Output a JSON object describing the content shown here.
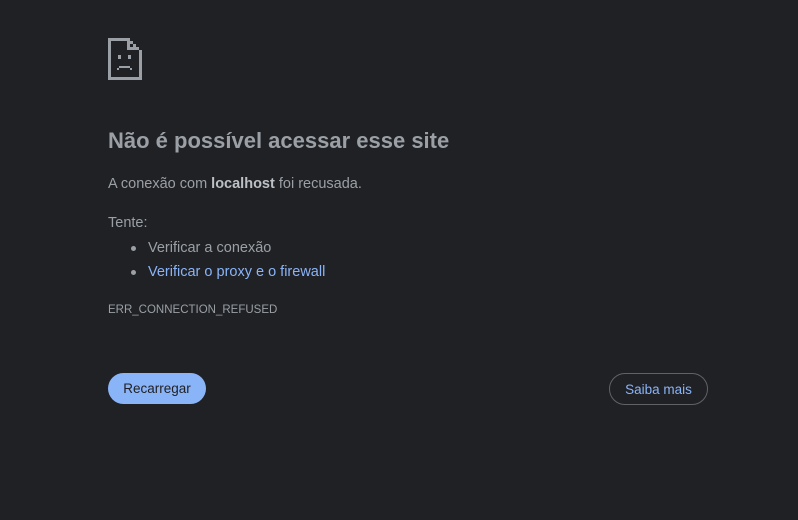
{
  "error": {
    "icon": "sad-document-icon",
    "title": "Não é possível acessar esse site",
    "description_before": "A conexão com ",
    "host": "localhost",
    "description_after": " foi recusada.",
    "try_label": "Tente:",
    "suggestions": [
      {
        "label": "Verificar a conexão",
        "link": false
      },
      {
        "label": "Verificar o proxy e o firewall",
        "link": true
      }
    ],
    "code": "ERR_CONNECTION_REFUSED"
  },
  "buttons": {
    "reload_label": "Recarregar",
    "learn_more_label": "Saiba mais"
  },
  "colors": {
    "background": "#202124",
    "text": "#9aa0a6",
    "accent": "#8ab4f8"
  }
}
